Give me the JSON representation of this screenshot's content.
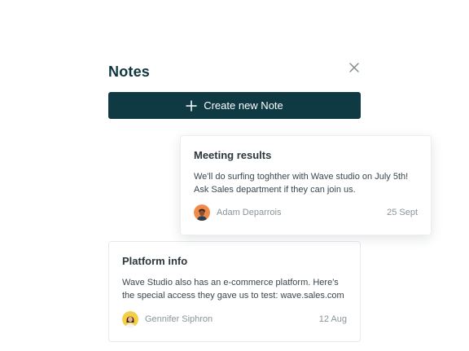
{
  "panel": {
    "title": "Notes",
    "create_button_label": "Create new Note"
  },
  "icons": {
    "close": "close-icon",
    "plus": "plus-icon"
  },
  "colors": {
    "primary": "#0f3a44",
    "title": "#103640",
    "muted": "#8a9499"
  },
  "notes": [
    {
      "title": "Meeting results",
      "body_line1": "We'll do surfing toghther with Wave studio on July 5th!",
      "body_line2": "Ask Sales department if they can join us.",
      "author": "Adam Deparrois",
      "date": "25 Sept",
      "avatar_color": "#f08a4b"
    },
    {
      "title": "Platform info",
      "body_line1": "Wave Studio also has an e-commerce platform. Here's",
      "body_line2": "the special access they gave us to test: wave.sales.com",
      "author": "Gennifer Siphron",
      "date": "12 Aug",
      "avatar_color": "#f3cf4a"
    }
  ]
}
